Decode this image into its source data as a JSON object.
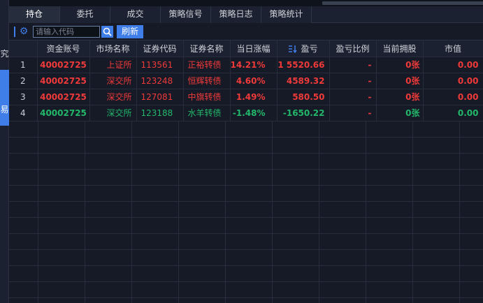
{
  "sidebar": {
    "char_top": "究",
    "char_active": "易"
  },
  "tabs": [
    {
      "label": "持仓",
      "active": true
    },
    {
      "label": "委托"
    },
    {
      "label": "成交"
    },
    {
      "label": "策略信号"
    },
    {
      "label": "策略日志"
    },
    {
      "label": "策略统计"
    }
  ],
  "toolbar": {
    "search_placeholder": "请输入代码",
    "refresh_label": "刷新"
  },
  "table": {
    "headers": [
      "",
      "资金账号",
      "市场名称",
      "证券代码",
      "证券名称",
      "当日涨幅",
      "盈亏",
      "盈亏比例",
      "当前拥股",
      "市值"
    ],
    "rows": [
      {
        "idx": "1",
        "account": "40002725",
        "market": "上证所",
        "code": "113561",
        "name": "正裕转债",
        "change": "14.21%",
        "pl": "1 5520.66",
        "pl_ratio": "-",
        "holding": "0张",
        "market_value": "0.00",
        "color": "red"
      },
      {
        "idx": "2",
        "account": "40002725",
        "market": "深交所",
        "code": "123248",
        "name": "恒辉转债",
        "change": "4.60%",
        "pl": "4589.32",
        "pl_ratio": "-",
        "holding": "0张",
        "market_value": "0.00",
        "color": "red"
      },
      {
        "idx": "3",
        "account": "40002725",
        "market": "深交所",
        "code": "127081",
        "name": "中旗转债",
        "change": "1.49%",
        "pl": "580.50",
        "pl_ratio": "-",
        "holding": "0张",
        "market_value": "0.00",
        "color": "red"
      },
      {
        "idx": "4",
        "account": "40002725",
        "market": "深交所",
        "code": "123188",
        "name": "水羊转债",
        "change": "-1.48%",
        "pl": "-1650.22",
        "pl_ratio": "-",
        "holding": "0张",
        "market_value": "0.00",
        "color": "green"
      }
    ]
  },
  "colors": {
    "up": "#f03a3a",
    "down": "#23b76a",
    "accent": "#3f7ee8"
  },
  "icons": {
    "settings": "gear-icon",
    "search": "search-icon",
    "sort": "sort-icon"
  }
}
